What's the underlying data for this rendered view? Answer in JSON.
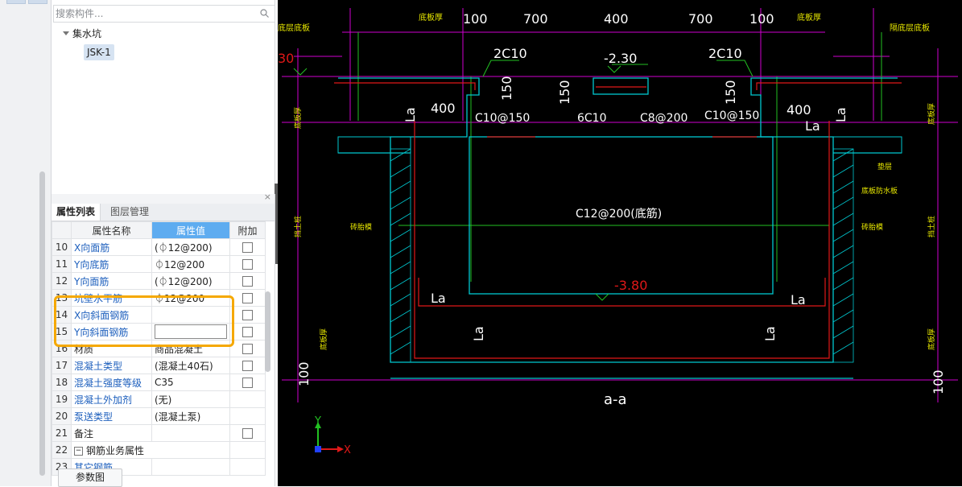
{
  "left_strip": {},
  "tree": {
    "search_placeholder": "搜索构件...",
    "group_label": "集水坑",
    "child_label": "JSK-1"
  },
  "props": {
    "tabs": [
      "属性列表",
      "图层管理"
    ],
    "headers": {
      "name": "属性名称",
      "value": "属性值",
      "extra": "附加"
    },
    "rows": [
      {
        "num": "10",
        "name": "X向面筋",
        "value": "(⏀12@200)",
        "check": true,
        "blue": true
      },
      {
        "num": "11",
        "name": "Y向底筋",
        "value": "⏀12@200",
        "check": true,
        "blue": true
      },
      {
        "num": "12",
        "name": "Y向面筋",
        "value": "(⏀12@200)",
        "check": true,
        "blue": true
      },
      {
        "num": "13",
        "name": "坑壁水平筋",
        "value": "⏀12@200",
        "check": true,
        "blue": true
      },
      {
        "num": "14",
        "name": "X向斜面钢筋",
        "value": "",
        "check": true,
        "blue": true
      },
      {
        "num": "15",
        "name": "Y向斜面钢筋",
        "value": "",
        "check": true,
        "blue": true,
        "editing": true
      },
      {
        "num": "16",
        "name": "材质",
        "value": "商品混凝土",
        "check": true,
        "blue": false
      },
      {
        "num": "17",
        "name": "混凝土类型",
        "value": "(混凝土40石)",
        "check": true,
        "blue": true
      },
      {
        "num": "18",
        "name": "混凝土强度等级",
        "value": "C35",
        "check": true,
        "blue": true
      },
      {
        "num": "19",
        "name": "混凝土外加剂",
        "value": "(无)",
        "check": false,
        "blue": true
      },
      {
        "num": "20",
        "name": "泵送类型",
        "value": "(混凝土泵)",
        "check": false,
        "blue": true
      },
      {
        "num": "21",
        "name": "备注",
        "value": "",
        "check": true,
        "blue": false
      },
      {
        "num": "22",
        "name": "钢筋业务属性",
        "value": "",
        "check": false,
        "blue": false,
        "group": true
      },
      {
        "num": "23",
        "name": "其它钢筋",
        "value": "",
        "check": false,
        "blue": true
      }
    ],
    "param_button": "参数图"
  },
  "cad": {
    "dims_top": [
      "100",
      "700",
      "400",
      "700",
      "100"
    ],
    "labels": {
      "top_left_note": "底板厚",
      "top_right_note": "底板厚",
      "left_edge_note": "底层底板",
      "right_edge_note": "隔底层底板",
      "rebar_2c10_left": "2C10",
      "rebar_2c10_right": "2C10",
      "level_top": "-2.30",
      "level_left": "30",
      "dim_150_a": "150",
      "dim_150_b": "150",
      "dim_150_c": "150",
      "dim_400_left": "400",
      "dim_400_right": "400",
      "la": "La",
      "c10_150_left": "C10@150",
      "c6c10": "6C10",
      "c8_200": "C8@200",
      "c10_150_right": "C10@150",
      "c12_200": "C12@200(底筋)",
      "level_bottom": "-3.80",
      "dim_100": "100",
      "section": "a-a",
      "side_thick": "底板厚",
      "side_pile": "挡土桩",
      "side_wall_l": "砖胎模",
      "side_wall_r": "砖胎模",
      "pad": "垫层",
      "waterproof": "底板防水板",
      "axis_x": "X",
      "axis_y": "Y"
    }
  }
}
